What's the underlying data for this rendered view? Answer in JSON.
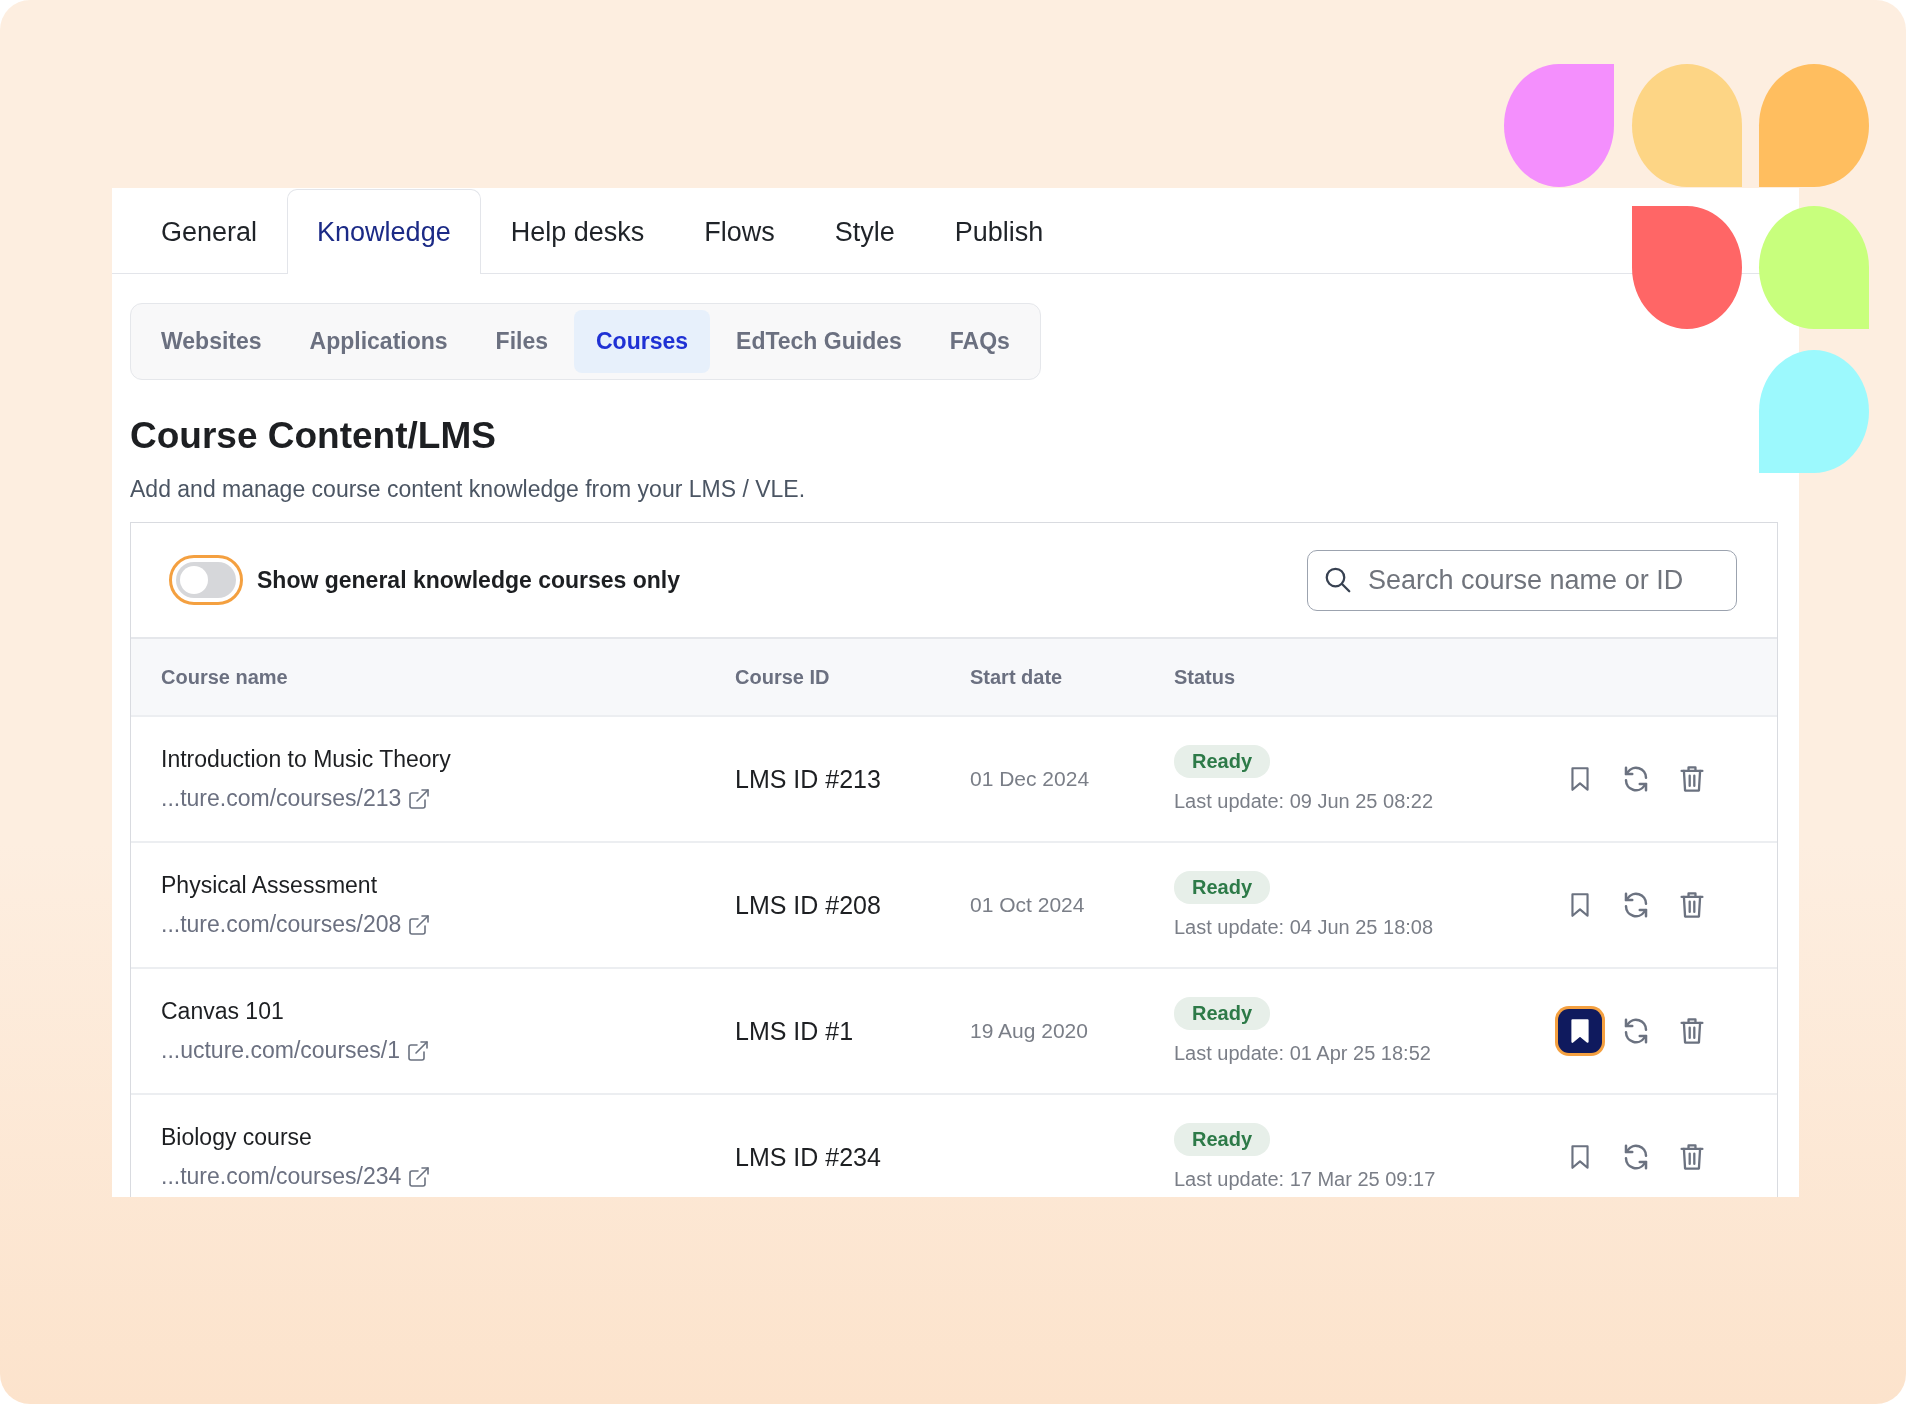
{
  "tabs": [
    {
      "label": "General",
      "selected": false
    },
    {
      "label": "Knowledge",
      "selected": true
    },
    {
      "label": "Help desks",
      "selected": false
    },
    {
      "label": "Flows",
      "selected": false
    },
    {
      "label": "Style",
      "selected": false
    },
    {
      "label": "Publish",
      "selected": false
    }
  ],
  "subtabs": [
    {
      "label": "Websites",
      "selected": false
    },
    {
      "label": "Applications",
      "selected": false
    },
    {
      "label": "Files",
      "selected": false
    },
    {
      "label": "Courses",
      "selected": true
    },
    {
      "label": "EdTech Guides",
      "selected": false
    },
    {
      "label": "FAQs",
      "selected": false
    }
  ],
  "title": "Course Content/LMS",
  "subtitle": "Add and manage course content knowledge from your LMS / VLE.",
  "filter_toggle": {
    "label": "Show general knowledge courses only",
    "on": false
  },
  "search": {
    "placeholder": "Search course name or ID"
  },
  "table": {
    "columns": [
      "Course name",
      "Course ID",
      "Start date",
      "Status"
    ],
    "rows": [
      {
        "name": "Introduction to Music Theory",
        "url": "...ture.com/courses/213",
        "course_id": "LMS ID #213",
        "start_date": "01 Dec 2024",
        "status": "Ready",
        "last_update": "Last update: 09 Jun 25 08:22",
        "bookmarked": false
      },
      {
        "name": "Physical Assessment",
        "url": "...ture.com/courses/208",
        "course_id": "LMS ID #208",
        "start_date": "01 Oct 2024",
        "status": "Ready",
        "last_update": "Last update: 04 Jun 25 18:08",
        "bookmarked": false
      },
      {
        "name": "Canvas 101",
        "url": "...ucture.com/courses/1",
        "course_id": "LMS ID #1",
        "start_date": "19 Aug 2020",
        "status": "Ready",
        "last_update": "Last update: 01 Apr 25 18:52",
        "bookmarked": true
      },
      {
        "name": "Biology course",
        "url": "...ture.com/courses/234",
        "course_id": "LMS ID #234",
        "status": "Ready",
        "last_update": "Last update: 17 Mar 25 09:17",
        "bookmarked": false
      }
    ]
  }
}
